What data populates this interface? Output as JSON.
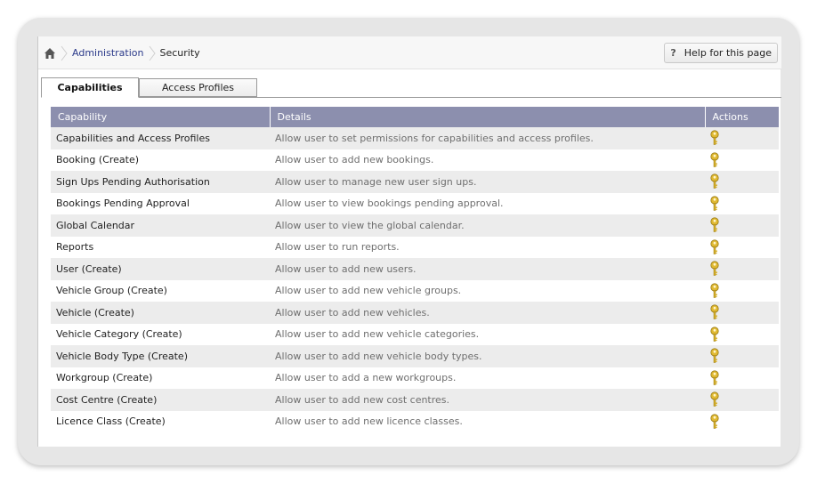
{
  "breadcrumb": {
    "home_icon": "home-icon",
    "items": [
      {
        "label": "Administration"
      },
      {
        "label": "Security"
      }
    ]
  },
  "help": {
    "icon": "?",
    "label": "Help for this page"
  },
  "tabs": [
    {
      "label": "Capabilities",
      "active": true
    },
    {
      "label": "Access Profiles",
      "active": false
    }
  ],
  "table": {
    "columns": [
      "Capability",
      "Details",
      "Actions"
    ],
    "rows": [
      {
        "capability": "Capabilities and Access Profiles",
        "details": "Allow user to set permissions for capabilities and access profiles.",
        "action_icon": "key-icon"
      },
      {
        "capability": "Booking (Create)",
        "details": "Allow user to add new bookings.",
        "action_icon": "key-icon"
      },
      {
        "capability": "Sign Ups Pending Authorisation",
        "details": "Allow user to manage new user sign ups.",
        "action_icon": "key-icon"
      },
      {
        "capability": "Bookings Pending Approval",
        "details": "Allow user to view bookings pending approval.",
        "action_icon": "key-icon"
      },
      {
        "capability": "Global Calendar",
        "details": "Allow user to view the global calendar.",
        "action_icon": "key-icon"
      },
      {
        "capability": "Reports",
        "details": "Allow user to run reports.",
        "action_icon": "key-icon"
      },
      {
        "capability": "User (Create)",
        "details": "Allow user to add new users.",
        "action_icon": "key-icon"
      },
      {
        "capability": "Vehicle Group (Create)",
        "details": "Allow user to add new vehicle groups.",
        "action_icon": "key-icon"
      },
      {
        "capability": "Vehicle (Create)",
        "details": "Allow user to add new vehicles.",
        "action_icon": "key-icon"
      },
      {
        "capability": "Vehicle Category (Create)",
        "details": "Allow user to add new vehicle categories.",
        "action_icon": "key-icon"
      },
      {
        "capability": "Vehicle Body Type (Create)",
        "details": "Allow user to add new vehicle body types.",
        "action_icon": "key-icon"
      },
      {
        "capability": "Workgroup (Create)",
        "details": "Allow user to add a new workgroups.",
        "action_icon": "key-icon"
      },
      {
        "capability": "Cost Centre (Create)",
        "details": "Allow user to add new cost centres.",
        "action_icon": "key-icon"
      },
      {
        "capability": "Licence Class (Create)",
        "details": "Allow user to add new licence classes.",
        "action_icon": "key-icon"
      }
    ]
  },
  "colors": {
    "header_bg": "#8c8fae",
    "row_alt": "#ececec",
    "link": "#2b3a8a",
    "key": "#d9b22a"
  }
}
